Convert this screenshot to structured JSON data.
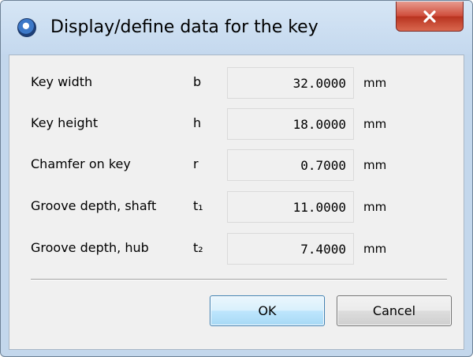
{
  "window": {
    "title": "Display/define data for the key"
  },
  "fields": [
    {
      "label": "Key width",
      "symbol": "b",
      "value": "32.0000",
      "unit": "mm"
    },
    {
      "label": "Key height",
      "symbol": "h",
      "value": "18.0000",
      "unit": "mm"
    },
    {
      "label": "Chamfer on key",
      "symbol": "r",
      "value": "0.7000",
      "unit": "mm"
    },
    {
      "label": "Groove depth, shaft",
      "symbol": "t₁",
      "value": "11.0000",
      "unit": "mm"
    },
    {
      "label": "Groove depth, hub",
      "symbol": "t₂",
      "value": "7.4000",
      "unit": "mm"
    }
  ],
  "buttons": {
    "ok_label": "OK",
    "cancel_label": "Cancel"
  },
  "colors": {
    "client_background": "#f0f0f0",
    "frame": "#c3d7ec",
    "close_button": "#c7432f",
    "ok_button_border": "#3c7fb1"
  },
  "icons": {
    "app": "app-icon",
    "close": "close-icon"
  }
}
